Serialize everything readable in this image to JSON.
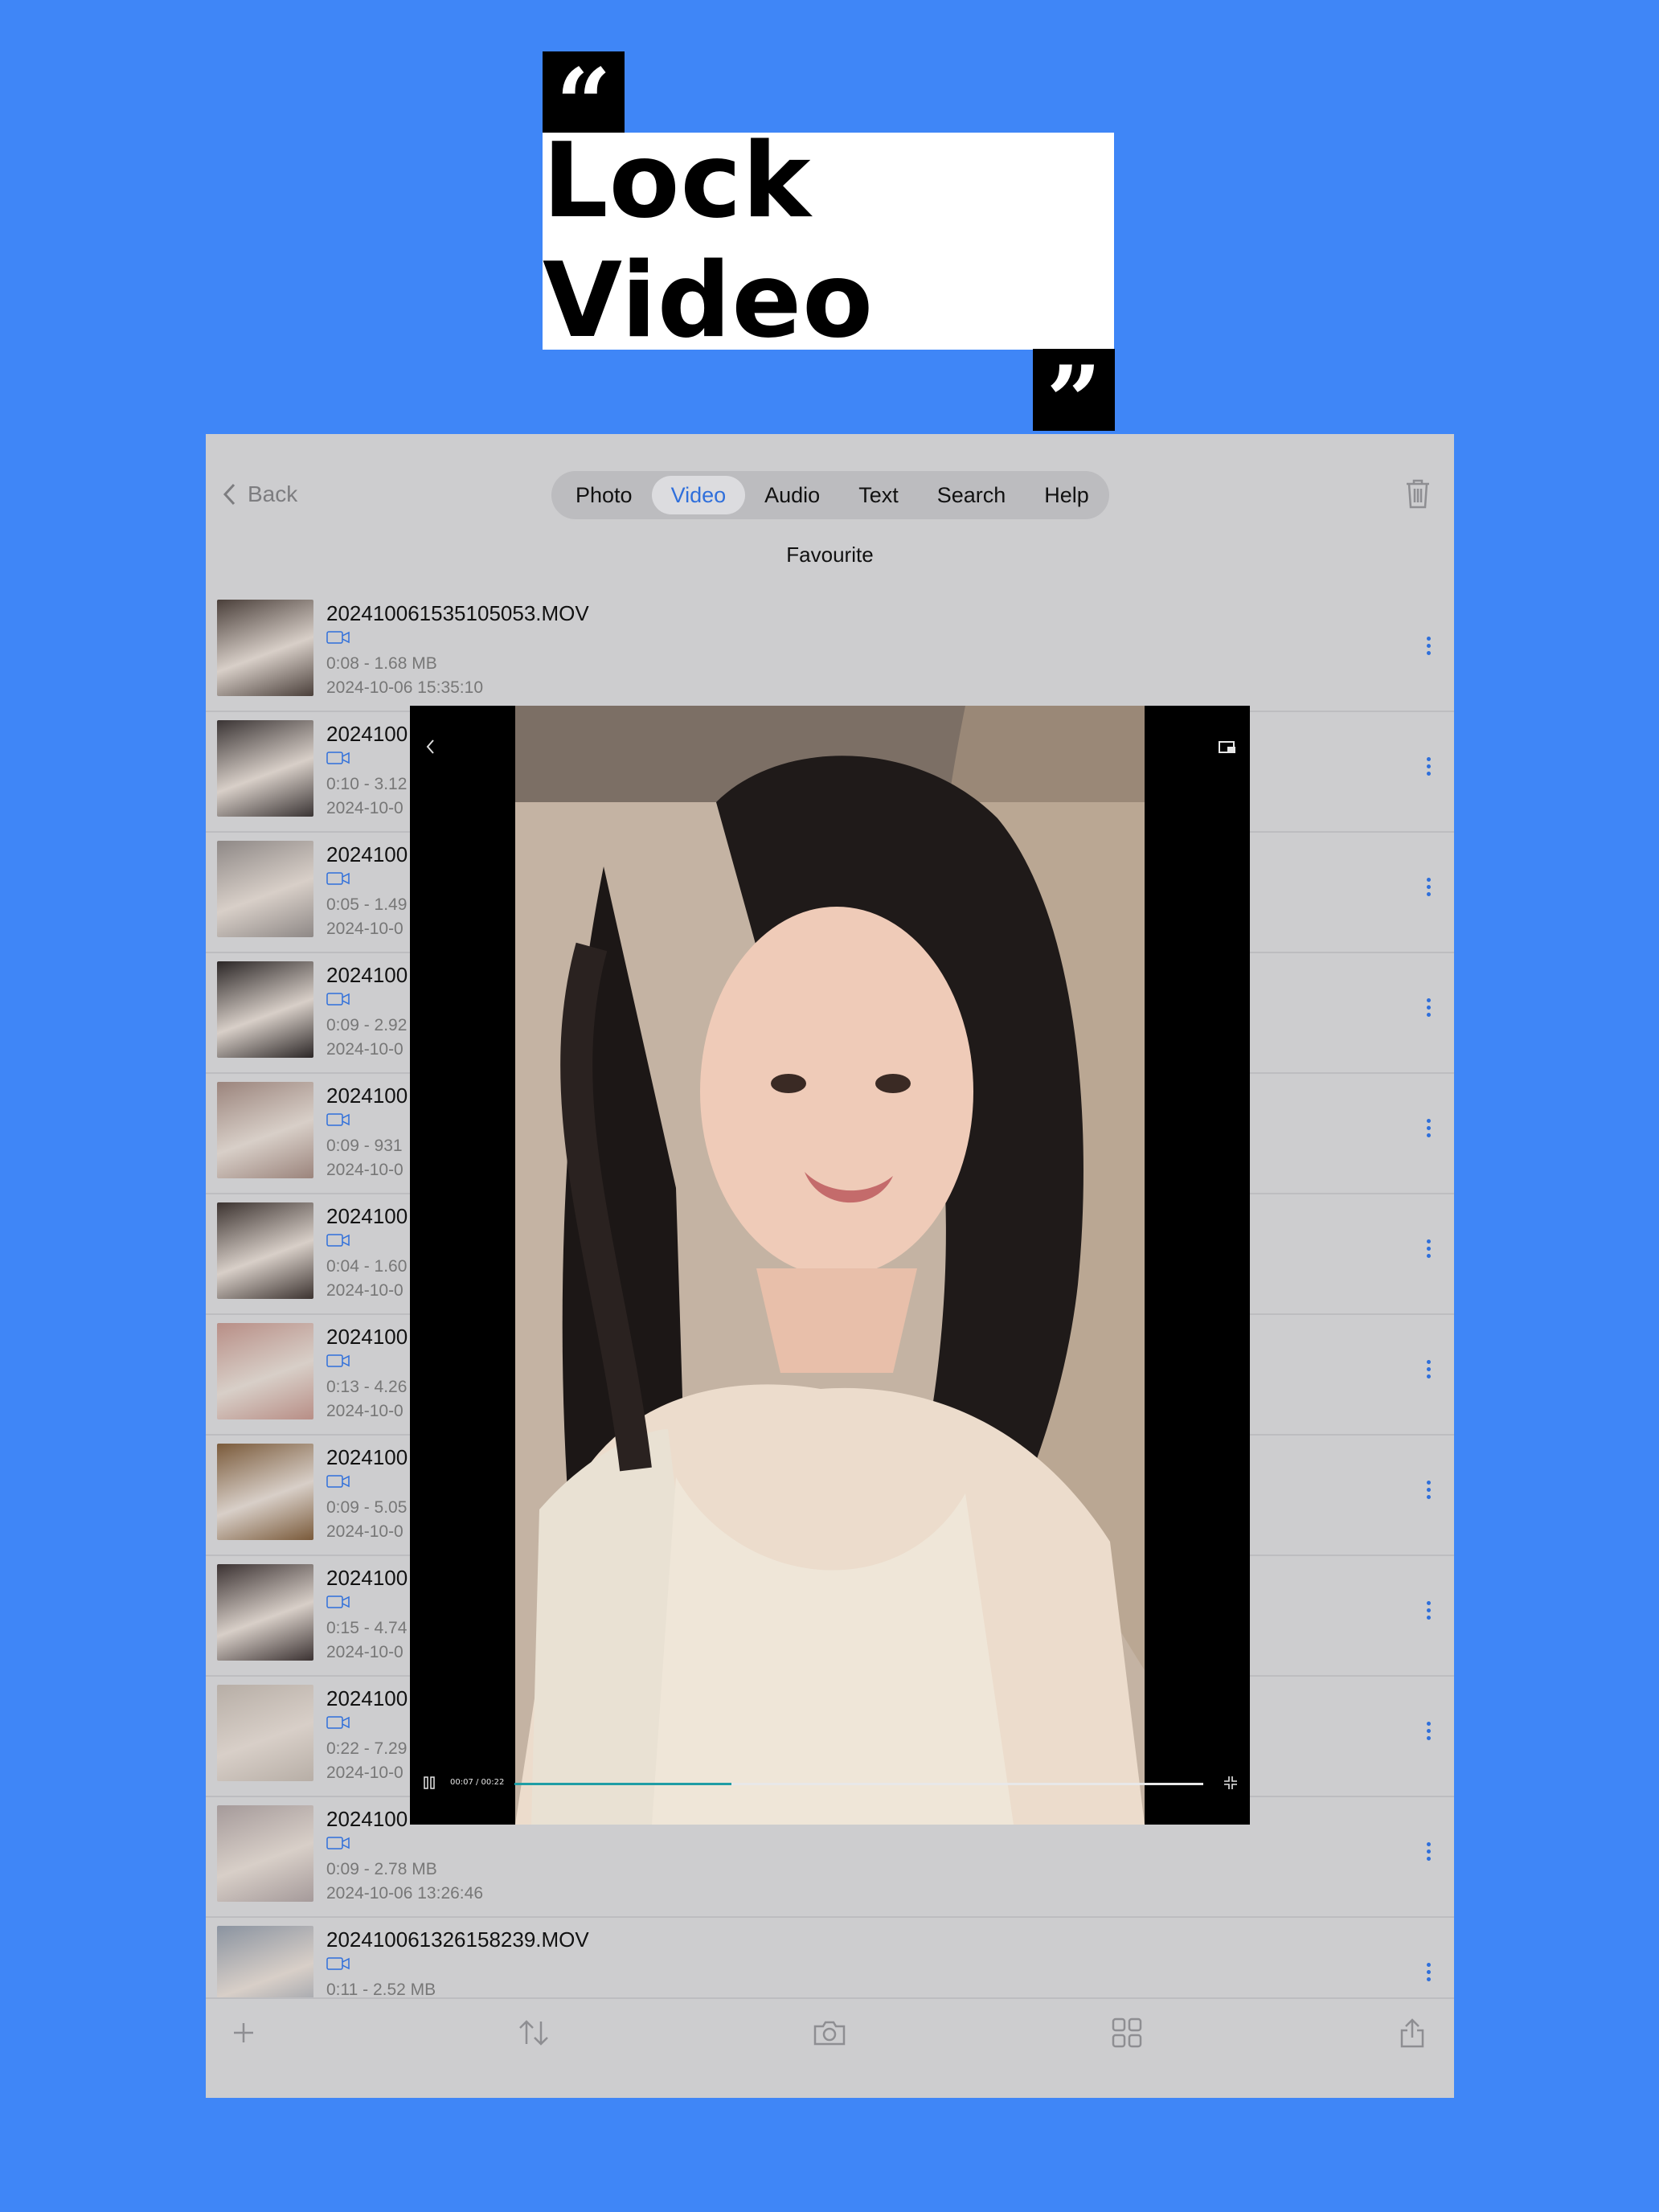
{
  "banner": {
    "title": "Lock Video",
    "open_quote": "“",
    "close_quote": "”"
  },
  "nav": {
    "back_label": "Back",
    "tabs": [
      {
        "label": "Photo",
        "active": false
      },
      {
        "label": "Video",
        "active": true
      },
      {
        "label": "Audio",
        "active": false
      },
      {
        "label": "Text",
        "active": false
      },
      {
        "label": "Search",
        "active": false
      },
      {
        "label": "Help",
        "active": false
      }
    ]
  },
  "section_title": "Favourite",
  "videos": [
    {
      "name": "20241006153510505​3.MOV",
      "meta": "0:08 - 1.68 MB",
      "date": "2024-10-06 15:35:10",
      "thumb": "#4a3f3a"
    },
    {
      "name": "2024100",
      "meta": "0:10 - 3.12",
      "date": "2024-10-0",
      "thumb": "#3a3434"
    },
    {
      "name": "2024100",
      "meta": "0:05 - 1.49",
      "date": "2024-10-0",
      "thumb": "#8e8886"
    },
    {
      "name": "2024100",
      "meta": "0:09 - 2.92",
      "date": "2024-10-0",
      "thumb": "#2b2626"
    },
    {
      "name": "2024100",
      "meta": "0:09 - 931",
      "date": "2024-10-0",
      "thumb": "#9b847c"
    },
    {
      "name": "2024100",
      "meta": "0:04 - 1.60",
      "date": "2024-10-0",
      "thumb": "#3c3330"
    },
    {
      "name": "2024100",
      "meta": "0:13 - 4.26",
      "date": "2024-10-0",
      "thumb": "#b88e86"
    },
    {
      "name": "2024100",
      "meta": "0:09 - 5.05",
      "date": "2024-10-0",
      "thumb": "#7a5a3a"
    },
    {
      "name": "2024100",
      "meta": "0:15 - 4.74",
      "date": "2024-10-0",
      "thumb": "#3b3232"
    },
    {
      "name": "2024100",
      "meta": "0:22 - 7.29",
      "date": "2024-10-0",
      "thumb": "#b7aea6"
    },
    {
      "name": "2024100",
      "meta": "0:09 - 2.78 MB",
      "date": "2024-10-06 13:26:46",
      "thumb": "#a59a9a"
    },
    {
      "name": "20241006132615823​9.MOV",
      "meta": "0:11 - 2.52 MB",
      "date": "",
      "thumb": "#8a93a0"
    }
  ],
  "player": {
    "time": "00:07 / 00:22",
    "progress": 0.315
  },
  "colors": {
    "background": "#3f86f7",
    "accent": "#2f6fdb",
    "progress": "#1f9da5"
  },
  "icons": [
    "back-chevron-icon",
    "trash-icon",
    "video-camera-icon",
    "more-icon",
    "plus-icon",
    "sort-icon",
    "camera-icon",
    "grid-icon",
    "share-icon",
    "pip-icon",
    "pause-icon",
    "exit-fullscreen-icon"
  ]
}
